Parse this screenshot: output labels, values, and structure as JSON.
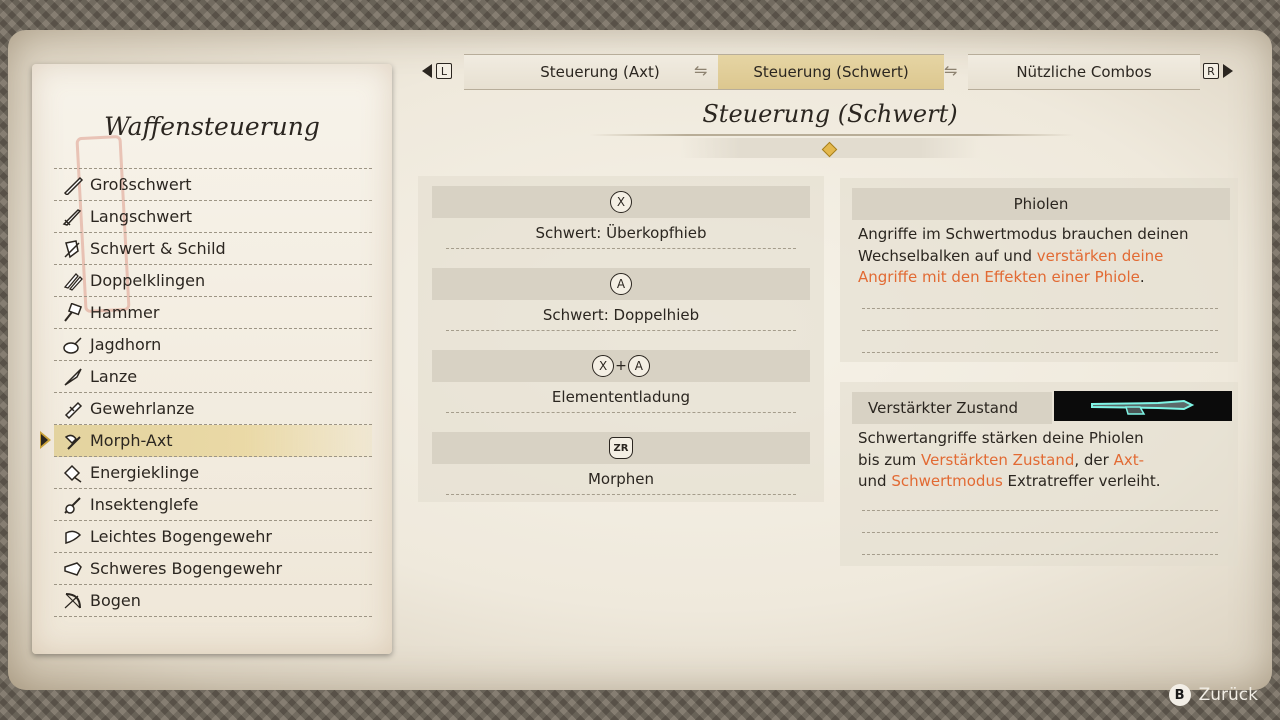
{
  "left_panel": {
    "title": "Waffensteuerung",
    "items": [
      {
        "label": "Großschwert",
        "icon": "great-sword-icon"
      },
      {
        "label": "Langschwert",
        "icon": "long-sword-icon"
      },
      {
        "label": "Schwert & Schild",
        "icon": "sword-and-shield-icon"
      },
      {
        "label": "Doppelklingen",
        "icon": "dual-blades-icon"
      },
      {
        "label": "Hammer",
        "icon": "hammer-icon"
      },
      {
        "label": "Jagdhorn",
        "icon": "hunting-horn-icon"
      },
      {
        "label": "Lanze",
        "icon": "lance-icon"
      },
      {
        "label": "Gewehrlanze",
        "icon": "gunlance-icon"
      },
      {
        "label": "Morph-Axt",
        "icon": "switch-axe-icon",
        "selected": true
      },
      {
        "label": "Energieklinge",
        "icon": "charge-blade-icon"
      },
      {
        "label": "Insektenglefe",
        "icon": "insect-glaive-icon"
      },
      {
        "label": "Leichtes Bogengewehr",
        "icon": "light-bowgun-icon"
      },
      {
        "label": "Schweres Bogengewehr",
        "icon": "heavy-bowgun-icon"
      },
      {
        "label": "Bogen",
        "icon": "bow-icon"
      }
    ]
  },
  "tabs": {
    "left_button": "L",
    "right_button": "R",
    "items": [
      {
        "label": "Steuerung (Axt)",
        "active": false
      },
      {
        "label": "Steuerung (Schwert)",
        "active": true
      },
      {
        "label": "Nützliche Combos",
        "active": false
      }
    ]
  },
  "main": {
    "heading": "Steuerung (Schwert)",
    "controls": [
      {
        "buttons": [
          "X"
        ],
        "label": "Schwert: Überkopfhieb"
      },
      {
        "buttons": [
          "A"
        ],
        "label": "Schwert: Doppelhieb"
      },
      {
        "buttons": [
          "X",
          "A"
        ],
        "label": "Elemententladung"
      },
      {
        "buttons": [
          "ZR"
        ],
        "label": "Morphen"
      }
    ]
  },
  "info": {
    "phiolen": {
      "title": "Phiolen",
      "text_1": "Angriffe im Schwertmodus brauchen deinen",
      "text_2a": "Wechselbalken auf und ",
      "text_2b": "verstärken deine",
      "text_3a": "Angriffe mit den Effekten einer Phiole",
      "text_3b": "."
    },
    "zustand": {
      "title": "Verstärkter Zustand",
      "text_1": "Schwertangriffe stärken deine Phiolen",
      "text_2a": "bis zum ",
      "text_2b": "Verstärkten Zustand",
      "text_2c": ", der ",
      "text_2d": "Axt-",
      "text_3a": "und ",
      "text_3b": "Schwertmodus",
      "text_3c": " Extratreffer verleiht."
    }
  },
  "footer": {
    "button": "B",
    "label": "Zurück"
  },
  "colors": {
    "highlight": "#e26a33",
    "selected_bg": "#e3d39f",
    "accent_gold": "#e4b84d"
  }
}
